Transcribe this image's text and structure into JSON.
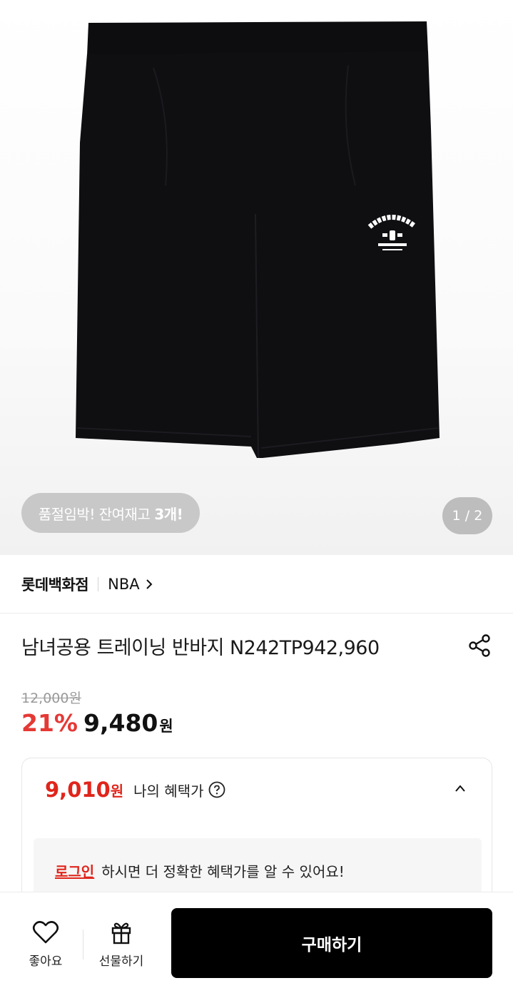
{
  "product_image": {
    "stock_badge_prefix": "품절임박! 잔여재고",
    "stock_badge_count": "3개!",
    "counter": "1 / 2"
  },
  "brand": {
    "store": "롯데백화점",
    "brand_name": "NBA"
  },
  "product": {
    "title": "남녀공용 트레이닝 반바지 N242TP942,960",
    "original_price": "12,000원",
    "discount": "21%",
    "sale_price": "9,480",
    "sale_unit": "원"
  },
  "benefit": {
    "price": "9,010",
    "unit": "원",
    "label": "나의 혜택가",
    "login_link": "로그인",
    "login_message": "하시면 더 정확한 혜택가를 알 수 있어요!"
  },
  "bottom_bar": {
    "like_label": "좋아요",
    "gift_label": "선물하기",
    "buy_label": "구매하기"
  },
  "colors": {
    "accent_red": "#e0251b",
    "buy_button": "#000000"
  }
}
